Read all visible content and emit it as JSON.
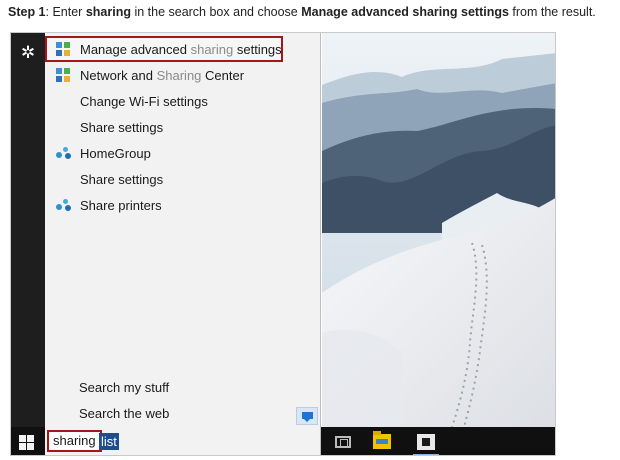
{
  "caption": {
    "step_label": "Step 1",
    "text_1": ": Enter ",
    "keyword": "sharing",
    "text_2": " in the search box and choose ",
    "target": "Manage advanced sharing settings",
    "text_3": " from the result."
  },
  "results": [
    {
      "icon": "control-panel-icon",
      "before": "Manage advanced ",
      "match": "sharing",
      "after": " settings",
      "selected": true
    },
    {
      "icon": "control-panel-icon",
      "before": "Network and ",
      "match": "Sharing",
      "after": " Center",
      "selected": false
    },
    {
      "icon": "none",
      "before": "Change Wi-Fi settings",
      "match": "",
      "after": "",
      "selected": false
    },
    {
      "icon": "none",
      "before": "Share settings",
      "match": "",
      "after": "",
      "selected": false
    },
    {
      "icon": "homegroup-icon",
      "before": "HomeGroup",
      "match": "",
      "after": "",
      "selected": false
    },
    {
      "icon": "none",
      "before": "Share settings",
      "match": "",
      "after": "",
      "selected": false
    },
    {
      "icon": "homegroup-icon",
      "before": "Share printers",
      "match": "",
      "after": "",
      "selected": false
    }
  ],
  "bottom": {
    "search_my_stuff": "Search my stuff",
    "search_the_web": "Search the web"
  },
  "search": {
    "typed": "sharing",
    "selected_suggestion": "list"
  },
  "icons": {
    "settings": "gear-icon",
    "start": "windows-start-icon",
    "task_view": "task-view-icon",
    "file_explorer": "file-explorer-icon",
    "store": "store-icon",
    "notification": "speech-bubble-icon"
  },
  "colors": {
    "highlight_box": "#a4161a",
    "match_text": "#8a8a8a",
    "selection": "#1f4e8c",
    "taskbar": "#101010"
  }
}
